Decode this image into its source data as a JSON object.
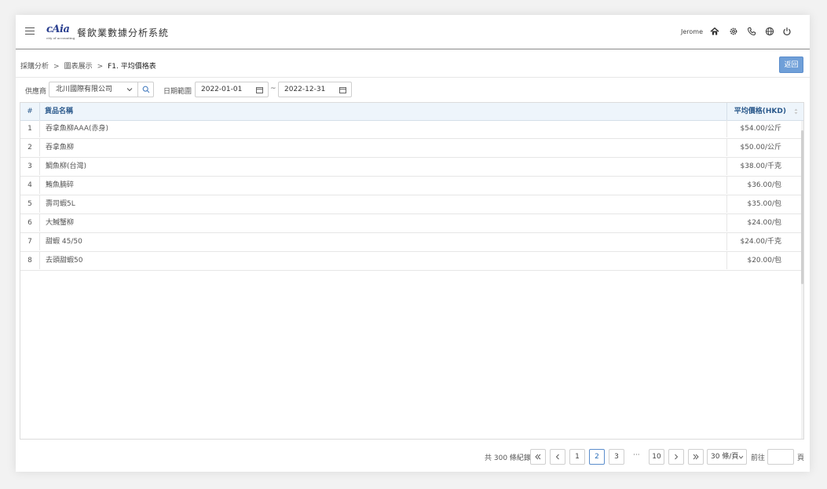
{
  "header": {
    "logo_text": "cAia",
    "logo_subtext": "city of accounting",
    "title": "餐飲業數據分析系統",
    "user": "Jerome"
  },
  "breadcrumb": {
    "items": [
      "採購分析",
      "圖表展示",
      "F1. 平均價格表"
    ],
    "separator": ">"
  },
  "back_button": "返回",
  "filters": {
    "supplier_label": "供應商",
    "supplier_value": "北川國際有限公司",
    "date_label": "日期範圍",
    "start_date": "2022-01-01",
    "end_date": "2022-12-31",
    "range_sep": "~"
  },
  "table": {
    "columns": [
      "#",
      "貨品名稱",
      "平均價格(HKD)"
    ],
    "rows": [
      {
        "num": "1",
        "name": "吞拿魚柳AAA(赤身)",
        "price": "$54.00/公斤"
      },
      {
        "num": "2",
        "name": "吞拿魚柳",
        "price": "$50.00/公斤"
      },
      {
        "num": "3",
        "name": "鯛魚柳(台灣)",
        "price": "$38.00/千克"
      },
      {
        "num": "4",
        "name": "鮪魚腩碎",
        "price": "$36.00/包"
      },
      {
        "num": "5",
        "name": "壽司蝦5L",
        "price": "$35.00/包"
      },
      {
        "num": "6",
        "name": "大鰔蟹柳",
        "price": "$24.00/包"
      },
      {
        "num": "7",
        "name": "甜蝦 45/50",
        "price": "$24.00/千克"
      },
      {
        "num": "8",
        "name": "去頭甜蝦50",
        "price": "$20.00/包"
      }
    ]
  },
  "pagination": {
    "total": "共 300 條紀錄",
    "pages": [
      "1",
      "2",
      "3",
      "10"
    ],
    "current": "2",
    "ellipsis": "···",
    "page_size": "30 條/頁",
    "goto_label": "前往",
    "goto_unit": "頁"
  }
}
